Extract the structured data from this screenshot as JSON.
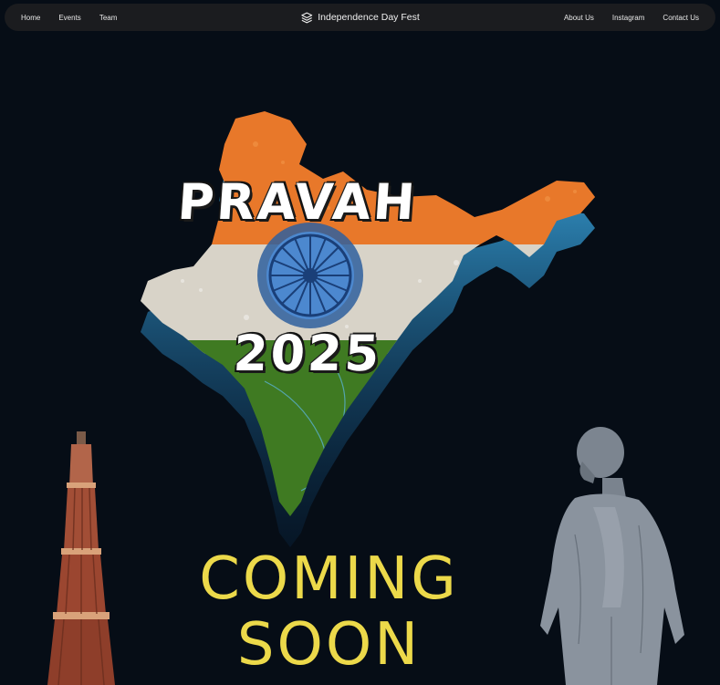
{
  "nav": {
    "left": [
      "Home",
      "Events",
      "Team"
    ],
    "brand": "Independence Day Fest",
    "right": [
      "About Us",
      "Instagram",
      "Contact Us"
    ]
  },
  "hero": {
    "title": "PRAVAH",
    "year": "2025",
    "coming_line1": "COMING",
    "coming_line2": "SOON"
  },
  "colors": {
    "background": "#060d16",
    "navbar": "#1b1c1f",
    "accent_yellow": "#ecd94a",
    "saffron": "#e8782a",
    "green": "#3f7a22",
    "chakra_blue": "#2b5ea8",
    "glow": "#3fb4f0"
  },
  "icons": {
    "brand": "layers-icon"
  }
}
